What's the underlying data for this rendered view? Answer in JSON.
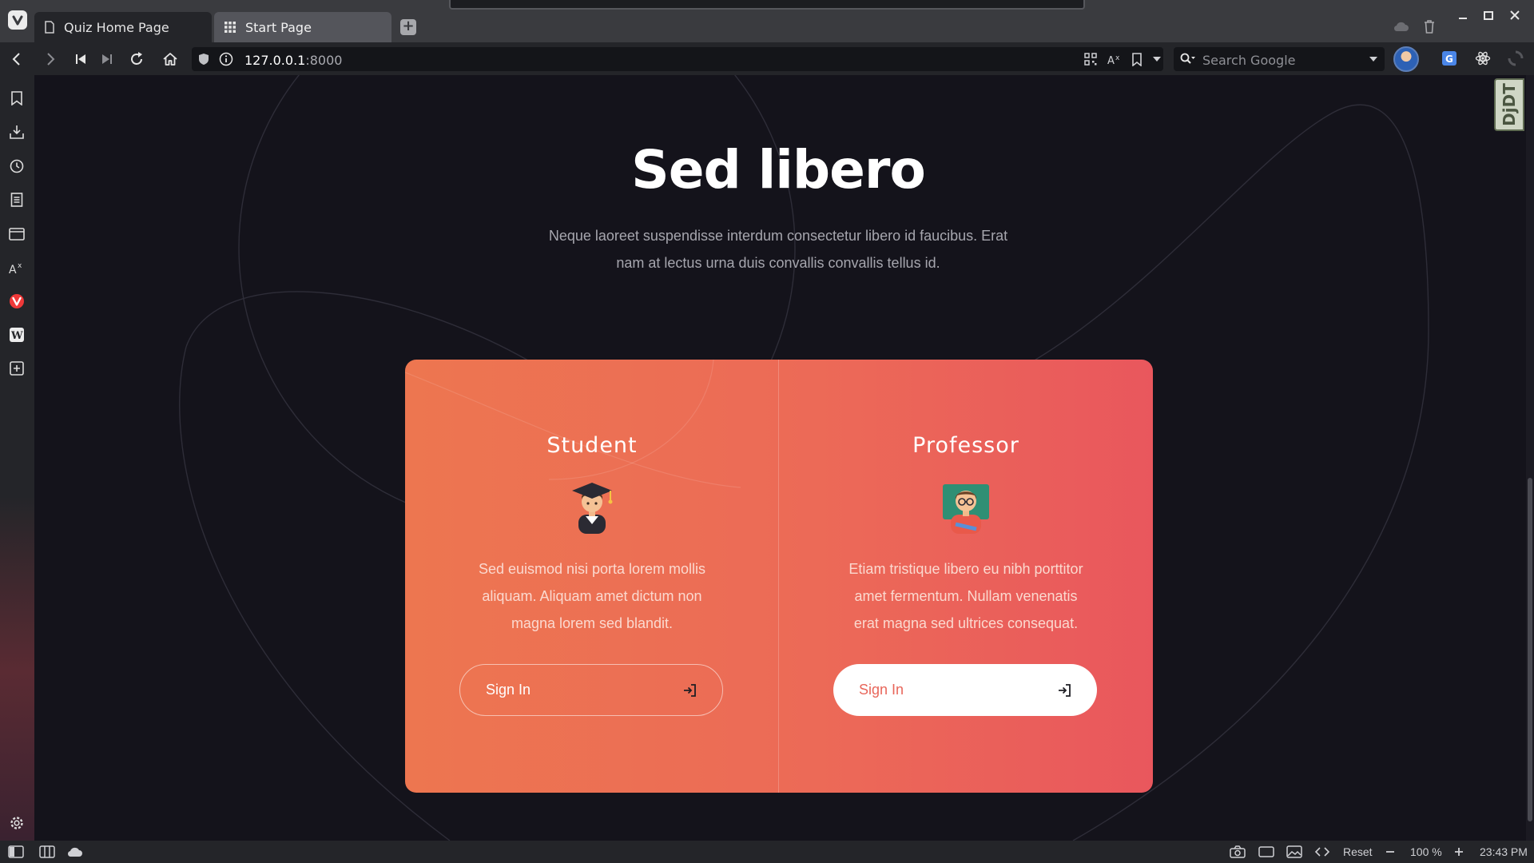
{
  "browser": {
    "tabs": [
      {
        "label": "Quiz Home Page",
        "icon": "document-icon",
        "active": true
      },
      {
        "label": "Start Page",
        "icon": "grid-icon",
        "active": false
      }
    ],
    "address": {
      "host": "127.0.0.1",
      "port": ":8000"
    },
    "search": {
      "placeholder": "Search Google"
    },
    "status": {
      "zoom": "100 %",
      "reset_label": "Reset",
      "time": "23:43 PM"
    }
  },
  "page": {
    "title": "Sed libero",
    "subtitle": "Neque laoreet suspendisse interdum consectetur libero id faucibus. Erat nam at lectus urna duis convallis convallis tellus id.",
    "roles": [
      {
        "title": "Student",
        "emoji": "student-emoji",
        "description": "Sed euismod nisi porta lorem mollis aliquam. Aliquam amet dictum non magna lorem sed blandit.",
        "button": "Sign In"
      },
      {
        "title": "Professor",
        "emoji": "teacher-emoji",
        "description": "Etiam tristique libero eu nibh porttitor amet fermentum. Nullam venenatis erat magna sed ultrices consequat.",
        "button": "Sign In"
      }
    ],
    "debug_toolbar": "DjDT"
  },
  "colors": {
    "background": "#14131b",
    "card_start": "#ed7650",
    "card_end": "#e9575d",
    "button_text": "#e8665a"
  }
}
